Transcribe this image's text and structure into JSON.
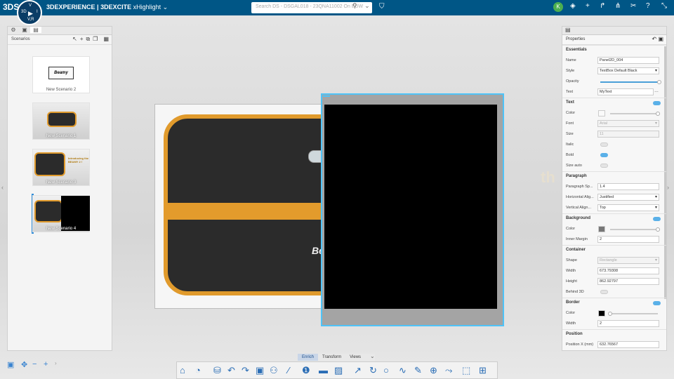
{
  "header": {
    "brand_logo": "3DS",
    "app_name_a": "3DEXPERIENCE",
    "app_name_b": "| 3DEXCITE",
    "app_module": "xHighlight",
    "compass_labels": [
      "3D",
      "V",
      "V,R",
      "I"
    ],
    "search_placeholder": "Search DS - DSGAL018 - 23QNA11002 On EUW",
    "user_initial": "K"
  },
  "left_panel": {
    "title": "Scenarios",
    "scenarios": [
      {
        "label": "New Scenario 2",
        "logo_text": "Beamy"
      },
      {
        "label": "New Scenario 1"
      },
      {
        "label": "New Scenario 3",
        "badge_text": "Introducing the BEAMY 2 !"
      },
      {
        "label": "New Scenario 4",
        "selected": true
      }
    ]
  },
  "viewport": {
    "bag_logo_text": "Be",
    "background_text": "th"
  },
  "properties": {
    "title": "Properties",
    "sections": {
      "essentials": "Essentials",
      "text": "Text",
      "paragraph": "Paragraph",
      "background": "Background",
      "container": "Container",
      "border": "Border",
      "position": "Position"
    },
    "name_label": "Name",
    "name_value": "Panel2D_004",
    "style_label": "Style",
    "style_value": "TextBox Default Black",
    "opacity_label": "Opacity",
    "text_label": "Text",
    "text_value": "MyText",
    "color_label": "Color",
    "font_label": "Font",
    "font_value": "Arial",
    "size_label": "Size",
    "size_value": "11",
    "italic_label": "Italic",
    "bold_label": "Bold",
    "sizeauto_label": "Size auto",
    "para_spacing_label": "Paragraph Sp...",
    "para_spacing_value": "1.4",
    "halign_label": "Horizontal Alig...",
    "halign_value": "Justified",
    "valign_label": "Vertical Align...",
    "valign_value": "Top",
    "bg_color_label": "Color",
    "inner_margin_label": "Inner Margin",
    "inner_margin_value": "2",
    "shape_label": "Shape",
    "shape_value": "Rectangle",
    "width_label": "Width",
    "width_value": "673.79308",
    "height_label": "Height",
    "height_value": "862.92797",
    "behind3d_label": "Behind 3D",
    "border_color_label": "Color",
    "border_width_label": "Width",
    "border_width_value": "2",
    "posx_label": "Position X (mm)",
    "posx_value": "632.76567"
  },
  "bottom": {
    "tabs": [
      "Enrich",
      "Transform",
      "Views"
    ],
    "active_tab": "Enrich"
  },
  "colors": {
    "topbar": "#005686",
    "accent": "#4fc3f7",
    "orange": "#e39b2c"
  }
}
